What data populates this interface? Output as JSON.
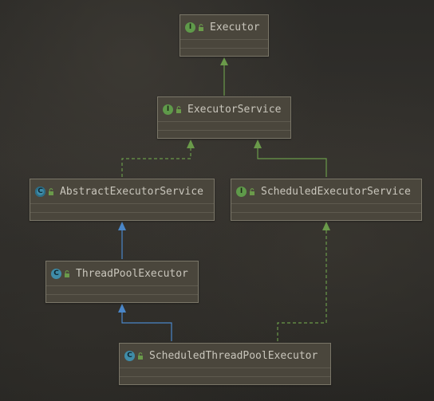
{
  "nodes": {
    "executor": {
      "name": "Executor",
      "kind": "I"
    },
    "executor_service": {
      "name": "ExecutorService",
      "kind": "I"
    },
    "abstract_executor_service": {
      "name": "AbstractExecutorService",
      "kind": "C"
    },
    "scheduled_executor_service": {
      "name": "ScheduledExecutorService",
      "kind": "I"
    },
    "thread_pool_executor": {
      "name": "ThreadPoolExecutor",
      "kind": "C"
    },
    "scheduled_thread_pool_executor": {
      "name": "ScheduledThreadPoolExecutor",
      "kind": "C"
    }
  },
  "colors": {
    "interface_extends": "#6a9a4a",
    "implements": "#6a9a4a",
    "class_extends": "#4a86c8"
  }
}
